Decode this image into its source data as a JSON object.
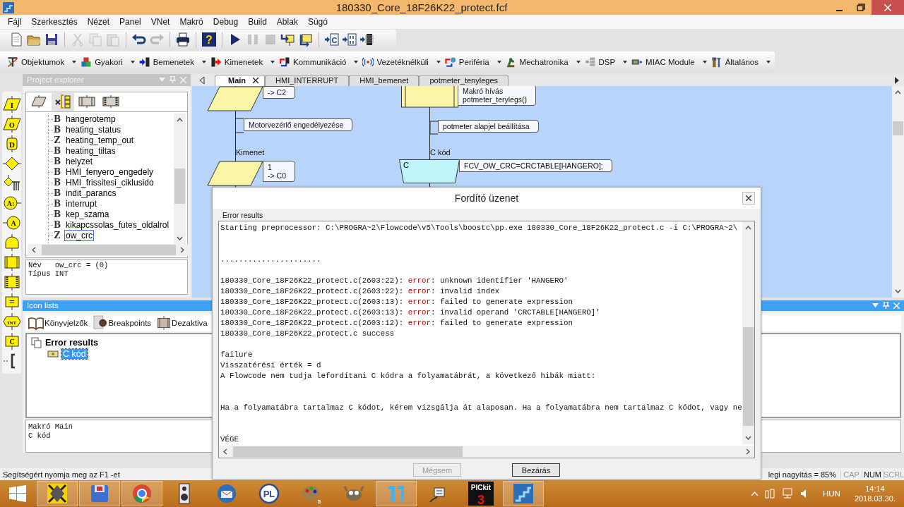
{
  "window": {
    "title": "180330_Core_18F26K22_protect.fcf"
  },
  "menu": [
    "Fájl",
    "Szerkesztés",
    "Nézet",
    "Panel",
    "VNet",
    "Makró",
    "Debug",
    "Build",
    "Ablak",
    "Súgó"
  ],
  "toolbar": [
    {
      "kind": "new",
      "disabled": false
    },
    {
      "kind": "open",
      "disabled": false
    },
    {
      "kind": "save",
      "disabled": false
    },
    {
      "kind": "separator"
    },
    {
      "kind": "cut",
      "disabled": true
    },
    {
      "kind": "copy",
      "disabled": true
    },
    {
      "kind": "paste",
      "disabled": true
    },
    {
      "kind": "separator"
    },
    {
      "kind": "undo",
      "disabled": false
    },
    {
      "kind": "redo",
      "disabled": true
    },
    {
      "kind": "separator"
    },
    {
      "kind": "print",
      "disabled": false
    },
    {
      "kind": "separator"
    },
    {
      "kind": "help",
      "disabled": false,
      "glyph": "?"
    },
    {
      "kind": "separator"
    },
    {
      "kind": "run",
      "disabled": false
    },
    {
      "kind": "pause",
      "disabled": true
    },
    {
      "kind": "stop",
      "disabled": true
    },
    {
      "kind": "step-into",
      "disabled": false
    },
    {
      "kind": "step-over",
      "disabled": false
    },
    {
      "kind": "separator"
    },
    {
      "kind": "compile-c",
      "disabled": false,
      "glyph": "C"
    },
    {
      "kind": "compile-hex",
      "disabled": false
    },
    {
      "kind": "compile-chip",
      "disabled": false
    }
  ],
  "component_toolbar": [
    {
      "kind": "objects",
      "label": "Objektumok"
    },
    {
      "kind": "cubes",
      "label": "Gyakori"
    },
    {
      "kind": "inputs",
      "label": "Bemenetek"
    },
    {
      "kind": "outputs",
      "label": "Kimenetek"
    },
    {
      "kind": "comms",
      "label": "Kommunikáció"
    },
    {
      "kind": "wireless",
      "label": "Vezetéknélküli"
    },
    {
      "kind": "peripheral",
      "label": "Periféria"
    },
    {
      "kind": "mechatronics",
      "label": "Mechatronika"
    },
    {
      "kind": "dsp",
      "label": "DSP"
    },
    {
      "kind": "module",
      "label": "MIAC Module"
    },
    {
      "kind": "tools",
      "label": "Általános"
    }
  ],
  "palette": [
    {
      "kind": "input",
      "glyph": "I"
    },
    {
      "kind": "output",
      "glyph": "O"
    },
    {
      "kind": "delay",
      "glyph": "D"
    },
    {
      "kind": "decision"
    },
    {
      "kind": "switch"
    },
    {
      "kind": "connection",
      "glyph": "A:"
    },
    {
      "kind": "jump",
      "glyph": "A"
    },
    {
      "kind": "loop"
    },
    {
      "kind": "macro"
    },
    {
      "kind": "component-macro"
    },
    {
      "kind": "calculation",
      "glyph": "="
    },
    {
      "kind": "interrupt",
      "glyph": "INT"
    },
    {
      "kind": "c-code",
      "glyph": "C"
    },
    {
      "kind": "comment"
    }
  ],
  "project_explorer": {
    "title": "Project explorer",
    "variables": [
      {
        "type": "B",
        "name": "hangerotemp",
        "selected": false
      },
      {
        "type": "B",
        "name": "heating_status",
        "selected": false
      },
      {
        "type": "Z",
        "name": "heating_temp_out",
        "selected": false
      },
      {
        "type": "B",
        "name": "heating_tiltas",
        "selected": false
      },
      {
        "type": "B",
        "name": "helyzet",
        "selected": false
      },
      {
        "type": "B",
        "name": "HMI_fenyero_engedely",
        "selected": false
      },
      {
        "type": "B",
        "name": "HMI_frissitesi_ciklusido",
        "selected": false
      },
      {
        "type": "B",
        "name": "indit_parancs",
        "selected": false
      },
      {
        "type": "B",
        "name": "interrupt",
        "selected": false
      },
      {
        "type": "B",
        "name": "kep_szama",
        "selected": false
      },
      {
        "type": "B",
        "name": "kikapcssolas_futes_oldalrol",
        "selected": false
      },
      {
        "type": "Z",
        "name": "ow_crc",
        "selected": true
      }
    ],
    "info": [
      "Név   ow_crc = (0)",
      "Típus INT"
    ]
  },
  "tabs": [
    {
      "label": "Main",
      "selected": true
    },
    {
      "label": "HMI_INTERRUPT",
      "selected": false
    },
    {
      "label": "HMI_bemenet",
      "selected": false
    },
    {
      "label": "potmeter_tenyleges",
      "selected": false
    }
  ],
  "flowchart": {
    "nodes": [
      {
        "kind": "output",
        "comment": [
          "-> C2"
        ]
      },
      {
        "kind": "comment",
        "comment": [
          "Motorvezérlő engedélyezése"
        ]
      },
      {
        "kind": "output",
        "label": "Kimenet",
        "comment": [
          "1",
          "-> C0"
        ]
      },
      {
        "kind": "macro",
        "comment": [
          "Makró hívás",
          "potmeter_terylegs()"
        ]
      },
      {
        "kind": "comment",
        "comment": [
          "potmeter alapjel beállítása"
        ]
      },
      {
        "kind": "c-code",
        "label": "C kód",
        "glyph": "C",
        "comment": [
          "FCV_OW_CRC=CRCTABLE[HANGERO];"
        ]
      }
    ]
  },
  "icon_lists": {
    "title": "Icon lists",
    "tabs": [
      {
        "kind": "bookmarks",
        "label": "Könyvjelzők"
      },
      {
        "kind": "breakpoints",
        "label": "Breakpoints"
      },
      {
        "kind": "disabled",
        "label": "Dezaktiva"
      }
    ],
    "tree": {
      "label": "Error results",
      "children": [
        {
          "label": "C kód",
          "selected": true
        }
      ]
    },
    "info": [
      "Makró Main",
      "C kód"
    ]
  },
  "dialog": {
    "title": "Fordító üzenet",
    "group_label": "Error results",
    "lines": [
      {
        "kind": "plain",
        "text": "Starting preprocessor: C:\\PROGRA~2\\Flowcode\\v5\\Tools\\boostc\\pp.exe 180330_Core_18F26K22_protect.c -i C:\\PROGRA~2\\"
      },
      {
        "kind": "blank"
      },
      {
        "kind": "blank"
      },
      {
        "kind": "plain",
        "text": "......................"
      },
      {
        "kind": "blank"
      },
      {
        "kind": "error",
        "location": "180330_Core_18F26K22_protect.c(2603:22):",
        "severity": "error",
        "message": ": unknown identifier 'HANGERO'"
      },
      {
        "kind": "error",
        "location": "180330_Core_18F26K22_protect.c(2603:22):",
        "severity": "error",
        "message": ": invalid index"
      },
      {
        "kind": "error",
        "location": "180330_Core_18F26K22_protect.c(2603:13):",
        "severity": "error",
        "message": ": failed to generate expression"
      },
      {
        "kind": "error",
        "location": "180330_Core_18F26K22_protect.c(2603:13):",
        "severity": "error",
        "message": ": invalid operand 'CRCTABLE[HANGERO]'"
      },
      {
        "kind": "error",
        "location": "180330_Core_18F26K22_protect.c(2603:12):",
        "severity": "error",
        "message": ": failed to generate expression"
      },
      {
        "kind": "plain",
        "text": "180330_Core_18F26K22_protect.c success"
      },
      {
        "kind": "blank"
      },
      {
        "kind": "plain",
        "text": "failure"
      },
      {
        "kind": "plain",
        "text": "Visszatérési érték = d"
      },
      {
        "kind": "plain",
        "text": "A Flowcode nem tudja lefordítani C kódra a folyamatábrát, a következő hibák miatt:"
      },
      {
        "kind": "blank"
      },
      {
        "kind": "blank"
      },
      {
        "kind": "plain",
        "text": "Ha a folyamatábra tartalmaz C kódot, kérem vizsgálja át alaposan. Ha a folyamatábra nem tartalmaz C kódot, vagy ne"
      },
      {
        "kind": "blank"
      },
      {
        "kind": "blank"
      },
      {
        "kind": "plain",
        "text": "VÉGE"
      }
    ],
    "buttons": [
      {
        "label": "Mégsem",
        "disabled": true
      },
      {
        "label": "Bezárás",
        "disabled": false
      }
    ]
  },
  "status_bar": {
    "help": "Segítségért nyomja meg az F1 -et",
    "zoom": "legi nagyítás = 85%",
    "indicators": [
      {
        "label": "CAP",
        "on": false
      },
      {
        "label": "NUM",
        "on": true
      },
      {
        "label": "SCRL",
        "on": false
      }
    ]
  },
  "taskbar": {
    "apps": [
      {
        "kind": "cube",
        "running": true
      },
      {
        "kind": "floppy",
        "running": true
      },
      {
        "kind": "browser",
        "running": true
      },
      {
        "kind": "speaker",
        "running": false
      },
      {
        "kind": "bird",
        "running": false
      },
      {
        "kind": "pl",
        "running": false,
        "glyph": "PL"
      },
      {
        "kind": "palette",
        "running": false,
        "badge": "5"
      },
      {
        "kind": "gimp",
        "running": false
      },
      {
        "kind": "h-app",
        "running": true
      },
      {
        "kind": "connector",
        "running": false
      },
      {
        "kind": "pickit",
        "running": false,
        "glyph": "PICkit",
        "badge": "3"
      },
      {
        "kind": "stairs",
        "running": true
      }
    ],
    "language": "HUN",
    "time": "14:14",
    "date": "2018.03.30."
  }
}
